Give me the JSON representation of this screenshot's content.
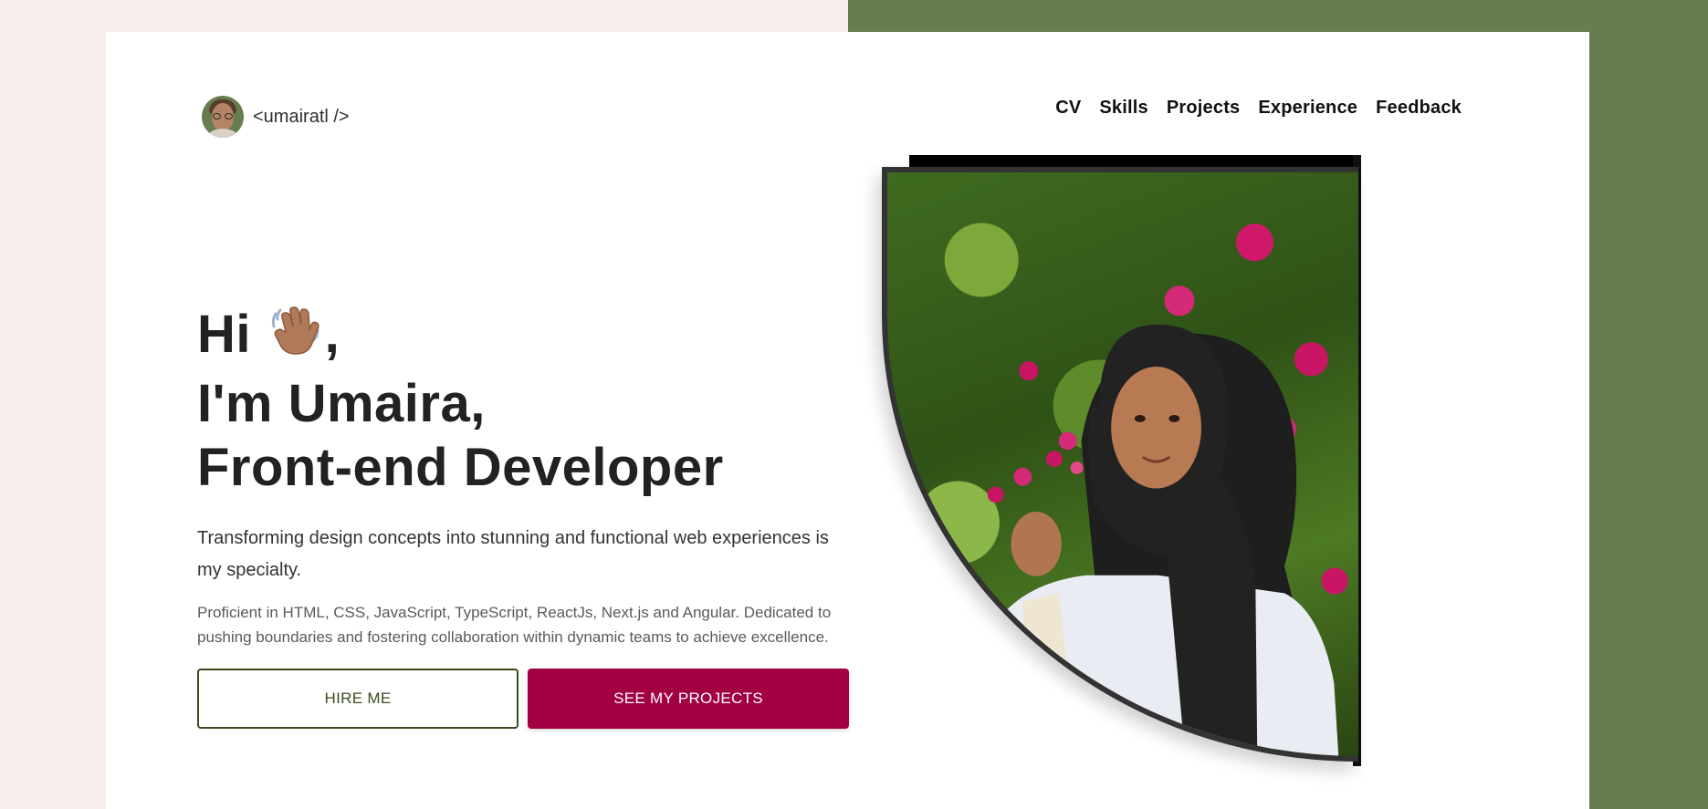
{
  "header": {
    "logo_text": "<umairatl />",
    "nav": [
      "CV",
      "Skills",
      "Projects",
      "Experience",
      "Feedback"
    ]
  },
  "hero": {
    "greeting": "Hi",
    "greeting_suffix": ",",
    "name_line": "I'm Umaira,",
    "role_line": "Front-end Developer",
    "tagline": "Transforming design concepts into stunning and functional web experiences is my specialty.",
    "description": "Proficient in HTML, CSS, JavaScript, TypeScript, ReactJs, Next.js and Angular. Dedicated to pushing boundaries and fostering collaboration within dynamic teams to achieve excellence.",
    "hire_label": "HIRE ME",
    "projects_label": "SEE MY PROJECTS"
  },
  "icons": {
    "wave": "waving-hand-icon",
    "avatar": "memoji-avatar"
  },
  "colors": {
    "left_background": "#f7eded",
    "right_background": "#667d4f",
    "primary_button": "#a20042",
    "outline_button": "#3a4a1f",
    "heading_text": "#222222"
  }
}
